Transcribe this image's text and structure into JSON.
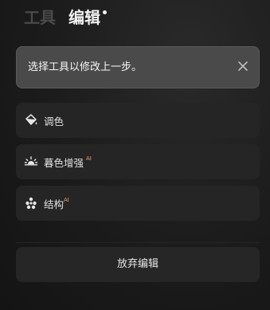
{
  "tabs": {
    "tools": "工具",
    "edit": "编辑"
  },
  "notice": {
    "text": "选择工具以修改上一步。"
  },
  "items": [
    {
      "label": "调色",
      "icon": "paint-bucket-icon",
      "ai": ""
    },
    {
      "label": "暮色增强",
      "icon": "sunset-icon",
      "ai": "AI"
    },
    {
      "label": "结构",
      "icon": "dots-cluster-icon",
      "ai": "AI"
    }
  ],
  "discard_label": "放弃编辑",
  "colors": {
    "ai_badge": "#f0a35b",
    "panel": "#252525",
    "notice": "#4a4a4a"
  }
}
